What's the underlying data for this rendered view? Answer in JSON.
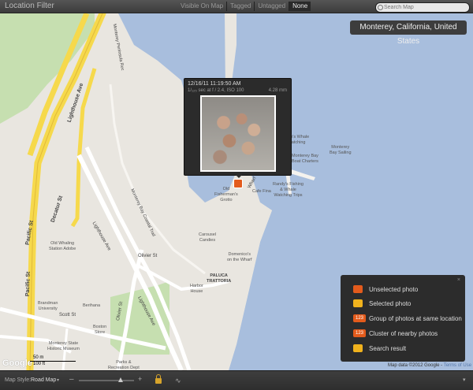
{
  "topbar": {
    "title": "Location Filter",
    "filters": [
      {
        "label": "Visible On Map"
      },
      {
        "label": "Tagged"
      },
      {
        "label": "Untagged"
      },
      {
        "label": "None"
      }
    ],
    "search_placeholder": "Search Map",
    "search_icon": "search-icon"
  },
  "map": {
    "location": "Monterey, California, United States",
    "roads": {
      "lighthouse_ave": "Lighthouse Ave",
      "decatur_st": "Decatur St",
      "pacific_st": "Pacific St",
      "scott_st": "Scott St",
      "olivier_st": "Olivier St",
      "lighthouse_ave2": "Lighthouse Ave",
      "lighthouse_ave3": "Lighthouse Ave",
      "bay_trail": "Monterey Bay Coastal Trail",
      "peninsula": "Monterey Peninsula Rec",
      "wharf": "Wharf"
    },
    "places": {
      "old_whaling": "Old Whaling\nStation Adobe",
      "brandman": "Brandman\nUniversity",
      "berihana": "Berihana",
      "boston_store": "Boston\nStore",
      "monterey_historic": "Monterey State\nHistoric Museum",
      "parks": "Parks &\nRecreation Dept",
      "harbor_house": "Harbor\nHouse",
      "paluca": "PALUCA\nTRATTORIA",
      "domenicos": "Domenico's\non the Wharf",
      "carousel": "Carousel\nCandies",
      "old_fishermans": "Old\nFisherman's\nGrotto",
      "cafe_fina": "Cafe Fina",
      "randys": "Randy's Fishing\n& Whale\nWatching Trips",
      "sam_whale": "Sam's Whale\nWatching",
      "bay_charters": "Monterey Bay\nBoat Charters",
      "bay_sailing": "Monterey\nBay Sailing"
    },
    "popup": {
      "date": "12/16/11 11:19:50 AM",
      "meta": "1/₁₂₅ sec at f / 2.4, ISO 100",
      "focal": "4.28 mm"
    },
    "scale": {
      "metric": "50 m",
      "imperial": "100 ft"
    },
    "attribution": "Map data ©2012 Google",
    "terms": "Terms of Use",
    "google": "Google"
  },
  "legend": {
    "close": "×",
    "items": [
      {
        "label": "Unselected photo",
        "color": "#e35b1c",
        "badge": ""
      },
      {
        "label": "Selected photo",
        "color": "#f0b21d",
        "badge": ""
      },
      {
        "label": "Group of photos at same location",
        "color": "#e35b1c",
        "badge": "123"
      },
      {
        "label": "Cluster of nearby photos",
        "color": "#e35b1c",
        "badge": "123"
      },
      {
        "label": "Search result",
        "color": "#f0b21d",
        "badge": ""
      }
    ]
  },
  "bottombar": {
    "map_style_label": "Map Style:",
    "map_style_value": "Road Map",
    "caret": "▾",
    "zoom_minus": "–",
    "zoom_plus": "+",
    "track_icon": "∿",
    "menu": "▾",
    "zoom_level": 0.75
  },
  "colors": {
    "water": "#a8bedd",
    "land": "#e9e6e0",
    "park": "#c6dfb0",
    "highway": "#f6d94c"
  }
}
